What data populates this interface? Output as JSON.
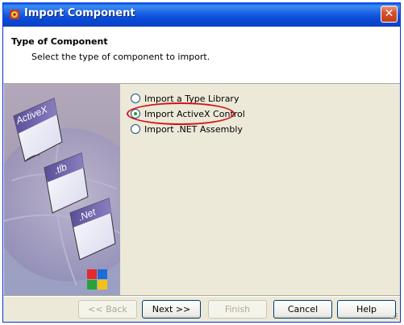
{
  "window": {
    "title": "Import Component",
    "close_glyph": "✕"
  },
  "header": {
    "title": "Type of Component",
    "subtitle": "Select the type of component to import."
  },
  "illustration": {
    "labels": [
      "ActiveX",
      ".tlb",
      ".Net"
    ]
  },
  "options": [
    {
      "label": "Import a Type Library",
      "selected": false
    },
    {
      "label": "Import ActiveX Control",
      "selected": true
    },
    {
      "label": "Import .NET Assembly",
      "selected": false
    }
  ],
  "buttons": {
    "back": "<< Back",
    "next": "Next >>",
    "finish": "Finish",
    "cancel": "Cancel",
    "help": "Help"
  },
  "colors": {
    "titlebar": "#0a57e7",
    "highlight": "#d2141c",
    "dialog_bg": "#ece9d8"
  }
}
